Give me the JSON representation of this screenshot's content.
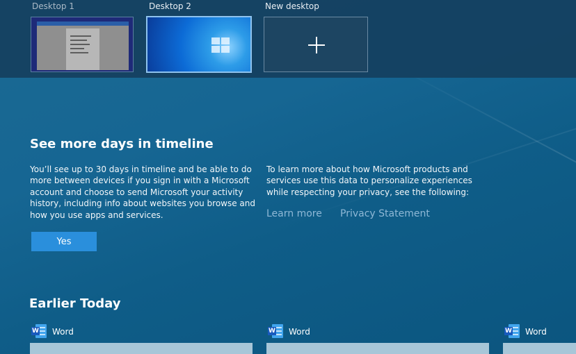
{
  "desktops": [
    {
      "label": "Desktop 1"
    },
    {
      "label": "Desktop 2"
    },
    {
      "label": "New desktop"
    }
  ],
  "promo": {
    "title": "See more days in timeline",
    "left_text": "You’ll see up to 30 days in timeline and be able to do more between devices if you sign in with a Microsoft account and choose to send Microsoft your activity history, including info about websites you browse and how you use apps and services.",
    "right_text": "To learn more about how Microsoft products and services use this data to personalize experiences while respecting your privacy, see the following:",
    "learn_more": "Learn more",
    "privacy": "Privacy Statement",
    "yes": "Yes"
  },
  "earlier": {
    "title": "Earlier Today",
    "cards": [
      {
        "app": "Word",
        "icon": "word-icon"
      },
      {
        "app": "Word",
        "icon": "word-icon"
      },
      {
        "app": "Word",
        "icon": "word-icon"
      }
    ]
  },
  "colors": {
    "accent_button": "#2a8fdc",
    "link": "#8fb8d6",
    "word_blue": "#185abd"
  }
}
